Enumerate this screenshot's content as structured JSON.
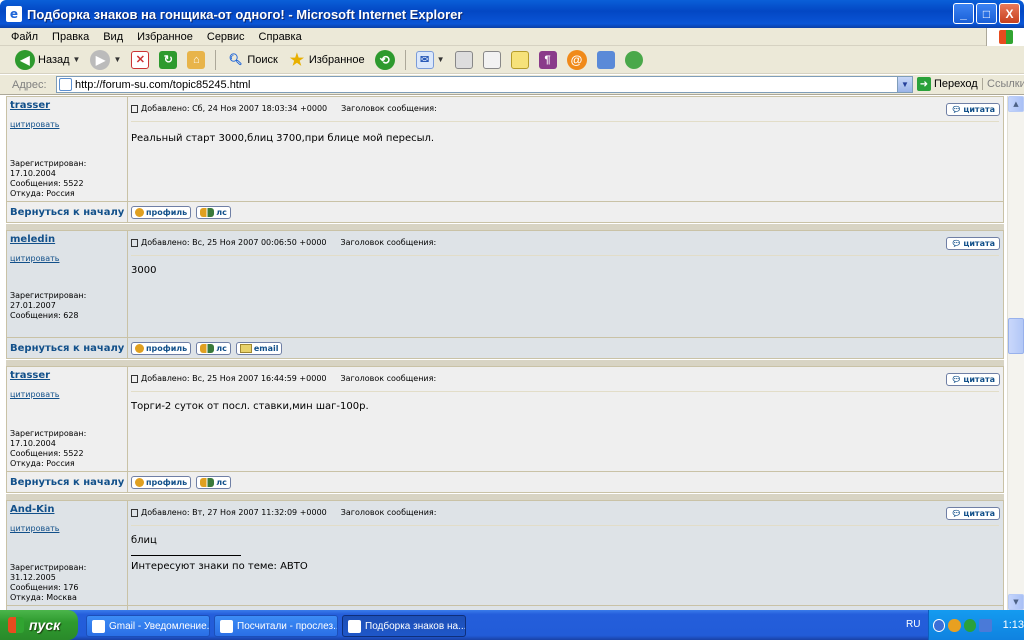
{
  "window": {
    "title": "Подборка знаков на гонщика-от одного! - Microsoft Internet Explorer",
    "minimize": "_",
    "maximize": "□",
    "close": "X"
  },
  "menu": [
    "Файл",
    "Правка",
    "Вид",
    "Избранное",
    "Сервис",
    "Справка"
  ],
  "toolbar": {
    "back_label": "Назад",
    "search_label": "Поиск",
    "favorites_label": "Избранное"
  },
  "address": {
    "label": "Адрес:",
    "url": "http://forum-su.com/topic85245.html",
    "go_label": "Переход",
    "links_label": "Ссылки"
  },
  "forum": {
    "back_to_top": "Вернуться к началу",
    "quote_btn": "цитата",
    "cite_link": "цитировать",
    "profile_btn": "профиль",
    "pm_btn": "лс",
    "email_btn": "email",
    "subject_label": "Заголовок сообщения:",
    "registered_label": "Зарегистрирован:",
    "posts_label": "Сообщения:",
    "from_label": "Откуда:",
    "posts": [
      {
        "author": "trasser",
        "registered": "17.10.2004",
        "post_count": "5522",
        "from": "Россия",
        "posted": "Добавлено: Сб, 24 Ноя 2007 18:03:34 +0000",
        "text": "Реальный старт 3000,блиц 3700,при блице мой пересыл."
      },
      {
        "author": "meledin",
        "registered": "27.01.2007",
        "post_count": "628",
        "posted": "Добавлено: Вс, 25 Ноя 2007 00:06:50 +0000",
        "text": "3000"
      },
      {
        "author": "trasser",
        "registered": "17.10.2004",
        "post_count": "5522",
        "from": "Россия",
        "posted": "Добавлено: Вс, 25 Ноя 2007 16:44:59 +0000",
        "text": "Торги-2 суток от посл. ставки,мин шаг-100р."
      },
      {
        "author": "And-Kin",
        "registered": "31.12.2005",
        "post_count": "176",
        "from": "Москва",
        "posted": "Добавлено: Вт, 27 Ноя 2007 11:32:09 +0000",
        "text": "блиц",
        "signature": "Интересуют знаки по теме: АВТО"
      }
    ]
  },
  "taskbar": {
    "start_label": "пуск",
    "tasks": [
      "Gmail - Уведомление...",
      "Посчитали - прослез...",
      "Подборка знаков на..."
    ],
    "lang": "RU",
    "clock": "1:13"
  }
}
